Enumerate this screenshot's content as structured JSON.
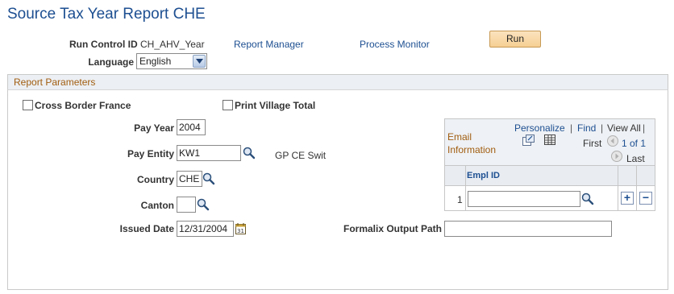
{
  "page": {
    "title": "Source Tax Year Report CHE"
  },
  "header": {
    "run_control_label": "Run Control ID",
    "run_control_value": "CH_AHV_Year",
    "report_manager_link": "Report Manager",
    "process_monitor_link": "Process Monitor",
    "run_button": "Run",
    "language_label": "Language",
    "language_value": "English"
  },
  "params": {
    "section_title": "Report Parameters",
    "cross_border_label": "Cross Border France",
    "cross_border_checked": false,
    "print_village_label": "Print Village Total",
    "print_village_checked": false,
    "pay_year_label": "Pay Year",
    "pay_year_value": "2004",
    "pay_entity_label": "Pay Entity",
    "pay_entity_value": "KW1",
    "pay_entity_desc": "GP CE Swit",
    "country_label": "Country",
    "country_value": "CHE",
    "canton_label": "Canton",
    "canton_value": "",
    "issued_date_label": "Issued Date",
    "issued_date_value": "12/31/2004",
    "formalix_label": "Formalix Output Path",
    "formalix_value": ""
  },
  "email_grid": {
    "title_line1": "Email",
    "title_line2": "Information",
    "personalize": "Personalize",
    "find": "Find",
    "view_all": "View All",
    "sep": "|",
    "first": "First",
    "range": "1 of 1",
    "last": "Last",
    "column": "Empl ID",
    "rows": [
      {
        "num": "1",
        "empl_id": ""
      }
    ]
  },
  "colors": {
    "title": "#1d4f91",
    "section_title": "#a15d10",
    "link": "#1d4f91",
    "button": "#f6cf93"
  },
  "icons": [
    "lookup-icon",
    "calendar-icon",
    "chevron-down-icon",
    "new-window-icon",
    "grid-download-icon",
    "prev-arrow-icon",
    "next-arrow-icon",
    "add-row-icon",
    "delete-row-icon"
  ]
}
